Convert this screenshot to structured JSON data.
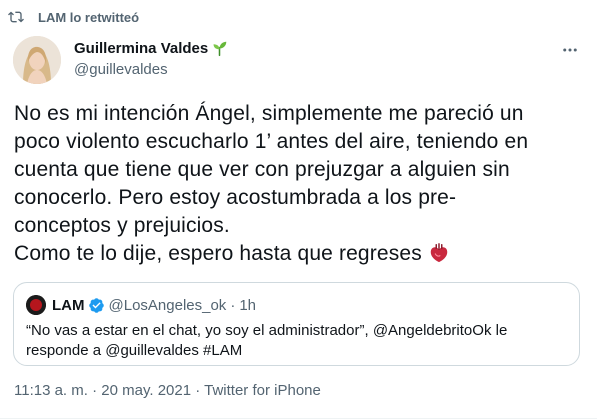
{
  "retweet": {
    "label": "LAM lo retwitteó",
    "icon": "retweet-icon"
  },
  "author": {
    "name": "Guillermina Valdes",
    "handle": "@guillevaldes",
    "name_emoji": "seedling-icon"
  },
  "tweet": {
    "lines": [
      "No es mi intención Ángel, simplemente me pareció un",
      "poco violento escucharlo 1’ antes del aire, teniendo en",
      "cuenta que tiene que ver con prejuzgar a alguien sin",
      "conocerlo. Pero estoy acostumbrada a los pre-",
      "conceptos y prejuicios.",
      "Como te lo dije, espero hasta que regreses"
    ],
    "trailing_emoji": "anatomical-heart-icon"
  },
  "quoted": {
    "name": "LAM",
    "handle": "@LosAngeles_ok",
    "separator": "·",
    "time": "1h",
    "lines": [
      "“No vas a estar en el chat, yo soy el administrador”, @AngeldebritoOk le",
      "responde a @guillevaldes #LAM"
    ]
  },
  "meta": {
    "time": "11:13 a. m.",
    "separator1": " · ",
    "date": "20 may. 2021",
    "separator2": " · ",
    "source": "Twitter for iPhone"
  },
  "colors": {
    "primary_text": "#0f1419",
    "secondary_text": "#536471",
    "verified": "#1d9bf0",
    "border": "#cfd9de"
  }
}
